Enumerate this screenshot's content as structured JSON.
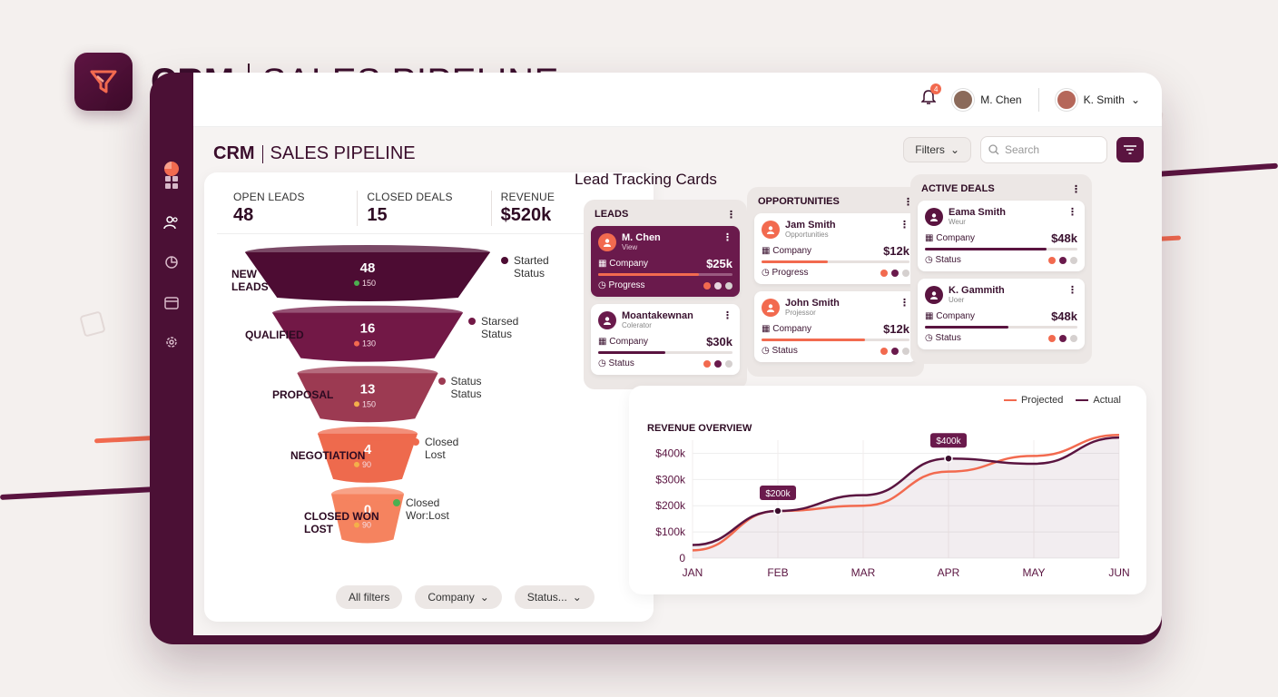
{
  "hero": {
    "brand": "CRM",
    "title": "SALES PIPELINE"
  },
  "header": {
    "notification_count": "4",
    "user1": "M. Chen",
    "user2": "K. Smith"
  },
  "page": {
    "brand": "CRM",
    "title": "SALES PIPELINE"
  },
  "toolbar": {
    "filters_label": "Filters",
    "search_placeholder": "Search"
  },
  "kpis": [
    {
      "label": "OPEN LEADS",
      "value": "48"
    },
    {
      "label": "CLOSED DEALS",
      "value": "15"
    },
    {
      "label": "REVENUE",
      "value": "$520k"
    }
  ],
  "funnel": [
    {
      "label": "NEW\nLEADS",
      "value": "48",
      "sub": "150",
      "status": "Started\nStatus",
      "color": "#4d0c33",
      "dot": "#4caf50"
    },
    {
      "label": "QUALIFIED",
      "value": "16",
      "sub": "130",
      "status": "Starsed\nStatus",
      "color": "#721846",
      "dot": "#f26a4f"
    },
    {
      "label": "PROPOSAL",
      "value": "13",
      "sub": "150",
      "status": "Status\nStatus",
      "color": "#9c3a52",
      "dot": "#f4b04a"
    },
    {
      "label": "NEGOTIATION",
      "value": "4",
      "sub": "90",
      "status": "Closed\nLost",
      "color": "#ee6a4d",
      "dot": "#f4b04a"
    },
    {
      "label": "CLOSED WON\nLOST",
      "value": "0",
      "sub": "90",
      "status": "Closed\nWor:Lost",
      "color": "#f5835f",
      "dot": "#f4b04a"
    }
  ],
  "funnel_filters": [
    "All filters",
    "Company",
    "Status..."
  ],
  "lead_tracking": {
    "title": "Lead Tracking Cards",
    "columns": [
      {
        "title": "LEADS",
        "cards": [
          {
            "name": "M. Chen",
            "role": "View",
            "company": "Company",
            "amount": "$25k",
            "footer": "Progress"
          },
          {
            "name": "Moantakewnan",
            "role": "Colerator",
            "company": "Company",
            "amount": "$30k",
            "footer": "Status"
          }
        ]
      },
      {
        "title": "OPPORTUNITIES",
        "cards": [
          {
            "name": "Jam Smith",
            "role": "Opportunities",
            "company": "Company",
            "amount": "$12k",
            "footer": "Progress"
          },
          {
            "name": "John Smith",
            "role": "Projessor",
            "company": "Company",
            "amount": "$12k",
            "footer": "Status"
          }
        ]
      },
      {
        "title": "ACTIVE DEALS",
        "cards": [
          {
            "name": "Eama Smith",
            "role": "Weur",
            "company": "Company",
            "amount": "$48k",
            "footer": "Status"
          },
          {
            "name": "K. Gammith",
            "role": "Uoer",
            "company": "Company",
            "amount": "$48k",
            "footer": "Status"
          }
        ]
      }
    ]
  },
  "chart_data": {
    "type": "line",
    "title": "REVENUE OVERVIEW",
    "categories": [
      "JAN",
      "FEB",
      "MAR",
      "APR",
      "MAY",
      "JUN"
    ],
    "y_ticks": [
      "0",
      "$100k",
      "$200k",
      "$300k",
      "$400k"
    ],
    "ylim": [
      0,
      450
    ],
    "series": [
      {
        "name": "Projected",
        "color": "#f26a4f",
        "values": [
          30,
          180,
          200,
          330,
          390,
          470
        ]
      },
      {
        "name": "Actual",
        "color": "#5a1440",
        "values": [
          50,
          180,
          240,
          380,
          360,
          460
        ]
      }
    ],
    "annotations": [
      {
        "label": "$200k",
        "category": "FEB",
        "value": 180
      },
      {
        "label": "$400k",
        "category": "APR",
        "value": 380
      }
    ]
  }
}
